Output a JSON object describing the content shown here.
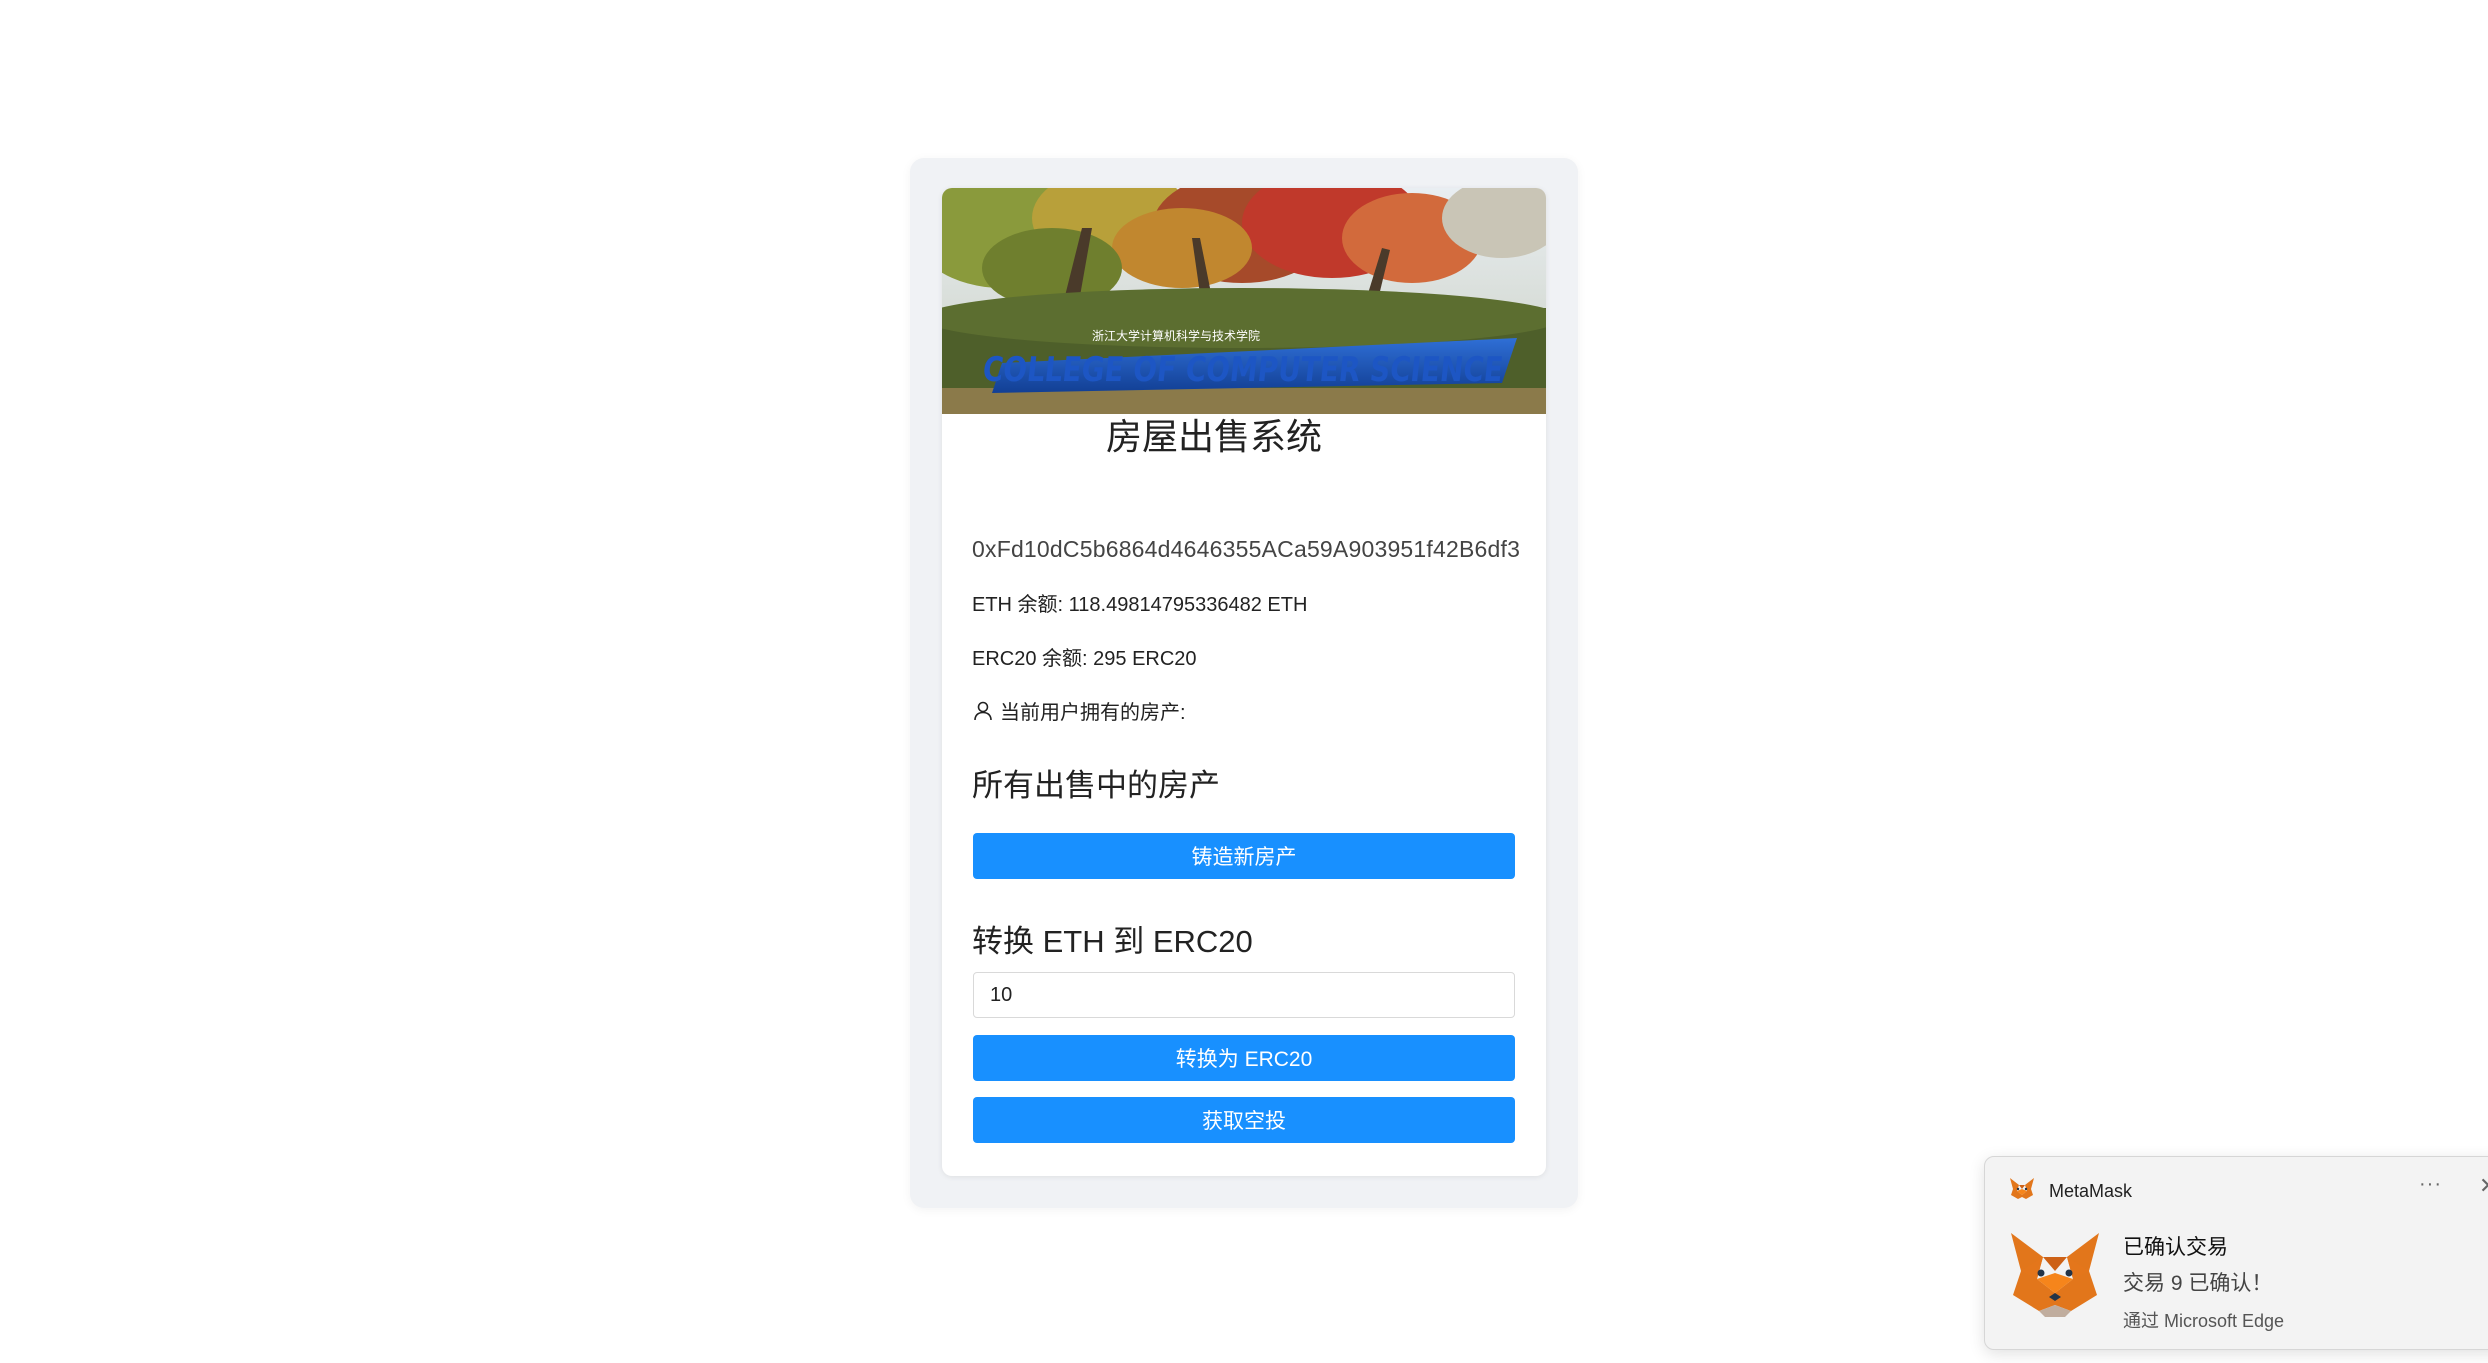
{
  "app": {
    "title": "房屋出售系统",
    "banner_text": "COLLEGE OF COMPUTER SCIENCE",
    "banner_subtext": "浙江大学计算机科学与技术学院"
  },
  "account": {
    "address": "0xFd10dC5b6864d4646355ACa59A903951f42B6df3",
    "eth_balance": "ETH 余额: 118.49814795336482 ETH",
    "erc20_balance": "ERC20 余额: 295 ERC20",
    "owned_label": "当前用户拥有的房产:"
  },
  "sale": {
    "heading": "所有出售中的房产",
    "mint_button": "铸造新房产"
  },
  "convert": {
    "heading": "转换 ETH 到 ERC20",
    "input_value": "10",
    "convert_button": "转换为 ERC20",
    "airdrop_button": "获取空投"
  },
  "notification": {
    "app_name": "MetaMask",
    "more": "···",
    "close": "✕",
    "title": "已确认交易",
    "message": "交易 9 已确认！",
    "via": "通过 Microsoft Edge"
  },
  "colors": {
    "primary": "#1890ff",
    "outer_bg": "#f0f2f5",
    "fox_orange": "#e2761b"
  }
}
